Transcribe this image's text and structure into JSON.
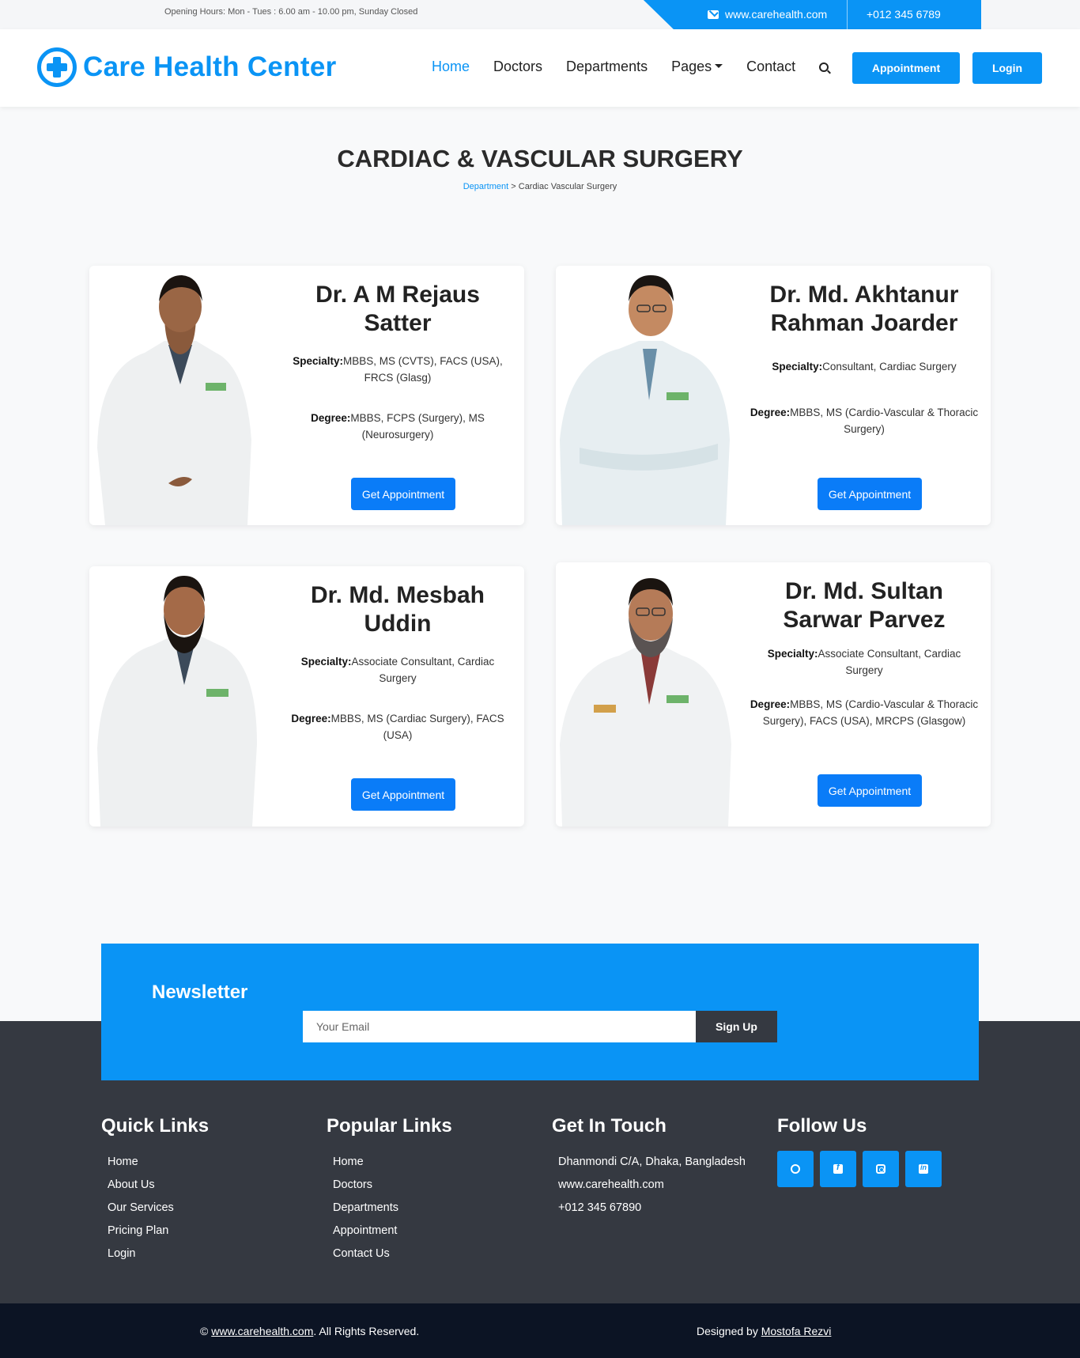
{
  "topbar": {
    "hours": "Opening Hours: Mon - Tues : 6.00 am - 10.00 pm, Sunday Closed",
    "website": "www.carehealth.com",
    "phone": "+012 345 6789"
  },
  "navbar": {
    "brand": "Care Health Center",
    "links": [
      "Home",
      "Doctors",
      "Departments",
      "Pages",
      "Contact"
    ],
    "appointment_label": "Appointment",
    "login_label": "Login"
  },
  "header": {
    "title": "CARDIAC & VASCULAR SURGERY",
    "breadcrumb_link": "Department",
    "breadcrumb_sep": " > ",
    "breadcrumb_current": "Cardiac Vascular Surgery"
  },
  "doctors": [
    {
      "name": "Dr. A M Rejaus Satter",
      "specialty_label": "Specialty:",
      "specialty": "MBBS, MS (CVTS), FACS (USA), FRCS (Glasg)",
      "degree_label": "Degree:",
      "degree": "MBBS, FCPS (Surgery), MS (Neurosurgery)",
      "button": "Get Appointment"
    },
    {
      "name": "Dr. Md. Akhtanur Rahman Joarder",
      "specialty_label": "Specialty:",
      "specialty": "Consultant, Cardiac Surgery",
      "degree_label": "Degree:",
      "degree": "MBBS, MS (Cardio-Vascular & Thoracic Surgery)",
      "button": "Get Appointment"
    },
    {
      "name": "Dr. Md. Mesbah Uddin",
      "specialty_label": "Specialty:",
      "specialty": "Associate Consultant, Cardiac Surgery",
      "degree_label": "Degree:",
      "degree": "MBBS, MS (Cardiac Surgery), FACS (USA)",
      "button": "Get Appointment"
    },
    {
      "name": "Dr. Md. Sultan Sarwar Parvez",
      "specialty_label": "Specialty:",
      "specialty": "Associate Consultant, Cardiac Surgery",
      "degree_label": "Degree:",
      "degree": "MBBS, MS (Cardio-Vascular & Thoracic Surgery), FACS (USA), MRCPS (Glasgow)",
      "button": "Get Appointment"
    }
  ],
  "newsletter": {
    "title": "Newsletter",
    "placeholder": "Your Email",
    "button": "Sign Up"
  },
  "footer": {
    "quick_title": "Quick Links",
    "quick_links": [
      "Home",
      "About Us",
      "Our Services",
      "Pricing Plan",
      "Login"
    ],
    "popular_title": "Popular Links",
    "popular_links": [
      "Home",
      "Doctors",
      "Departments",
      "Appointment",
      "Contact Us"
    ],
    "touch_title": "Get In Touch",
    "touch_items": [
      "Dhanmondi C/A, Dhaka, Bangladesh",
      "www.carehealth.com",
      "+012 345 67890"
    ],
    "follow_title": "Follow Us",
    "socials": [
      "whatsapp-icon",
      "facebook-icon",
      "instagram-icon",
      "linkedin-icon"
    ]
  },
  "bottombar": {
    "copy_symbol": "©",
    "copy_link": "www.carehealth.com",
    "copy_rest": ". All Rights Reserved.",
    "designed_by": "Designed by",
    "designer": "Mostofa Rezvi"
  },
  "colors": {
    "accent": "#0a94f5",
    "button": "#0a7cf8",
    "footer": "#353941",
    "bottombar": "#0c1424"
  }
}
